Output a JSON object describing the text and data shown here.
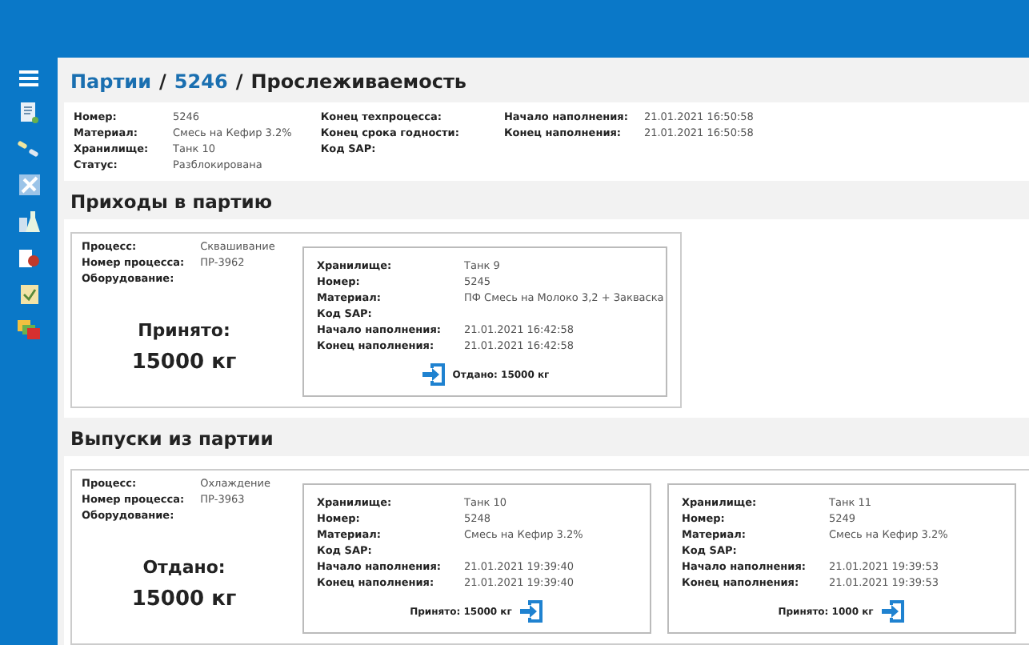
{
  "breadcrumb": {
    "items": [
      {
        "label": "Партии",
        "kind": "link"
      },
      {
        "label": "5246",
        "kind": "link"
      },
      {
        "label": "Прослеживаемость",
        "kind": "current"
      }
    ],
    "separator": "/"
  },
  "summary": {
    "columns": [
      [
        {
          "label": "Номер:",
          "value": "5246"
        },
        {
          "label": "Материал:",
          "value": "Смесь на Кефир  3.2%"
        },
        {
          "label": "Хранилище:",
          "value": "Танк 10"
        },
        {
          "label": "Статус:",
          "value": "Разблокирована"
        }
      ],
      [
        {
          "label": "Конец техпроцесса:"
        },
        {
          "label": "Конец срока годности:"
        },
        {
          "label": "Код SAP:"
        }
      ],
      [
        {
          "label": "Начало наполнения:",
          "value": "21.01.2021 16:50:58"
        },
        {
          "label": "Конец наполнения:",
          "value": "21.01.2021 16:50:58"
        }
      ]
    ]
  },
  "sections": [
    {
      "title": "Приходы в партию",
      "process": {
        "fields": [
          {
            "label": "Процесс:",
            "value": "Сквашивание"
          },
          {
            "label": "Номер процесса:",
            "value": "ПР-3962"
          },
          {
            "label": "Оборудование:"
          }
        ],
        "total_label": "Принято:",
        "total_value": "15000 кг"
      },
      "tanks": [
        {
          "fields": [
            {
              "label": "Хранилище:",
              "value": "Танк 9"
            },
            {
              "label": "Номер:",
              "value": "5245"
            },
            {
              "label": "Материал:",
              "value": "ПФ Смесь на Молоко 3,2 + Закваска"
            },
            {
              "label": "Код SAP:"
            },
            {
              "label": "Начало наполнения:",
              "value": "21.01.2021 16:42:58"
            },
            {
              "label": "Конец наполнения:",
              "value": "21.01.2021 16:42:58"
            }
          ],
          "transfer": "Отдано: 15000 кг",
          "kind": "out"
        }
      ]
    },
    {
      "title": "Выпуски из партии",
      "process": {
        "fields": [
          {
            "label": "Процесс:",
            "value": "Охлаждение"
          },
          {
            "label": "Номер процесса:",
            "value": "ПР-3963"
          },
          {
            "label": "Оборудование:"
          }
        ],
        "total_label": "Отдано:",
        "total_value": "15000 кг"
      },
      "tanks": [
        {
          "fields": [
            {
              "label": "Хранилище:",
              "value": "Танк 10"
            },
            {
              "label": "Номер:",
              "value": "5248"
            },
            {
              "label": "Материал:",
              "value": "Смесь на Кефир  3.2%"
            },
            {
              "label": "Код SAP:"
            },
            {
              "label": "Начало наполнения:",
              "value": "21.01.2021 19:39:40"
            },
            {
              "label": "Конец наполнения:",
              "value": "21.01.2021 19:39:40"
            }
          ],
          "transfer": "Принято: 15000 кг",
          "kind": "in"
        },
        {
          "fields": [
            {
              "label": "Хранилище:",
              "value": "Танк 11"
            },
            {
              "label": "Номер:",
              "value": "5249"
            },
            {
              "label": "Материал:",
              "value": "Смесь на Кефир  3.2%"
            },
            {
              "label": "Код SAP:"
            },
            {
              "label": "Начало наполнения:",
              "value": "21.01.2021 19:39:53"
            },
            {
              "label": "Конец наполнения:",
              "value": "21.01.2021 19:39:53"
            }
          ],
          "transfer": "Принято: 1000 кг",
          "kind": "in"
        }
      ]
    }
  ]
}
